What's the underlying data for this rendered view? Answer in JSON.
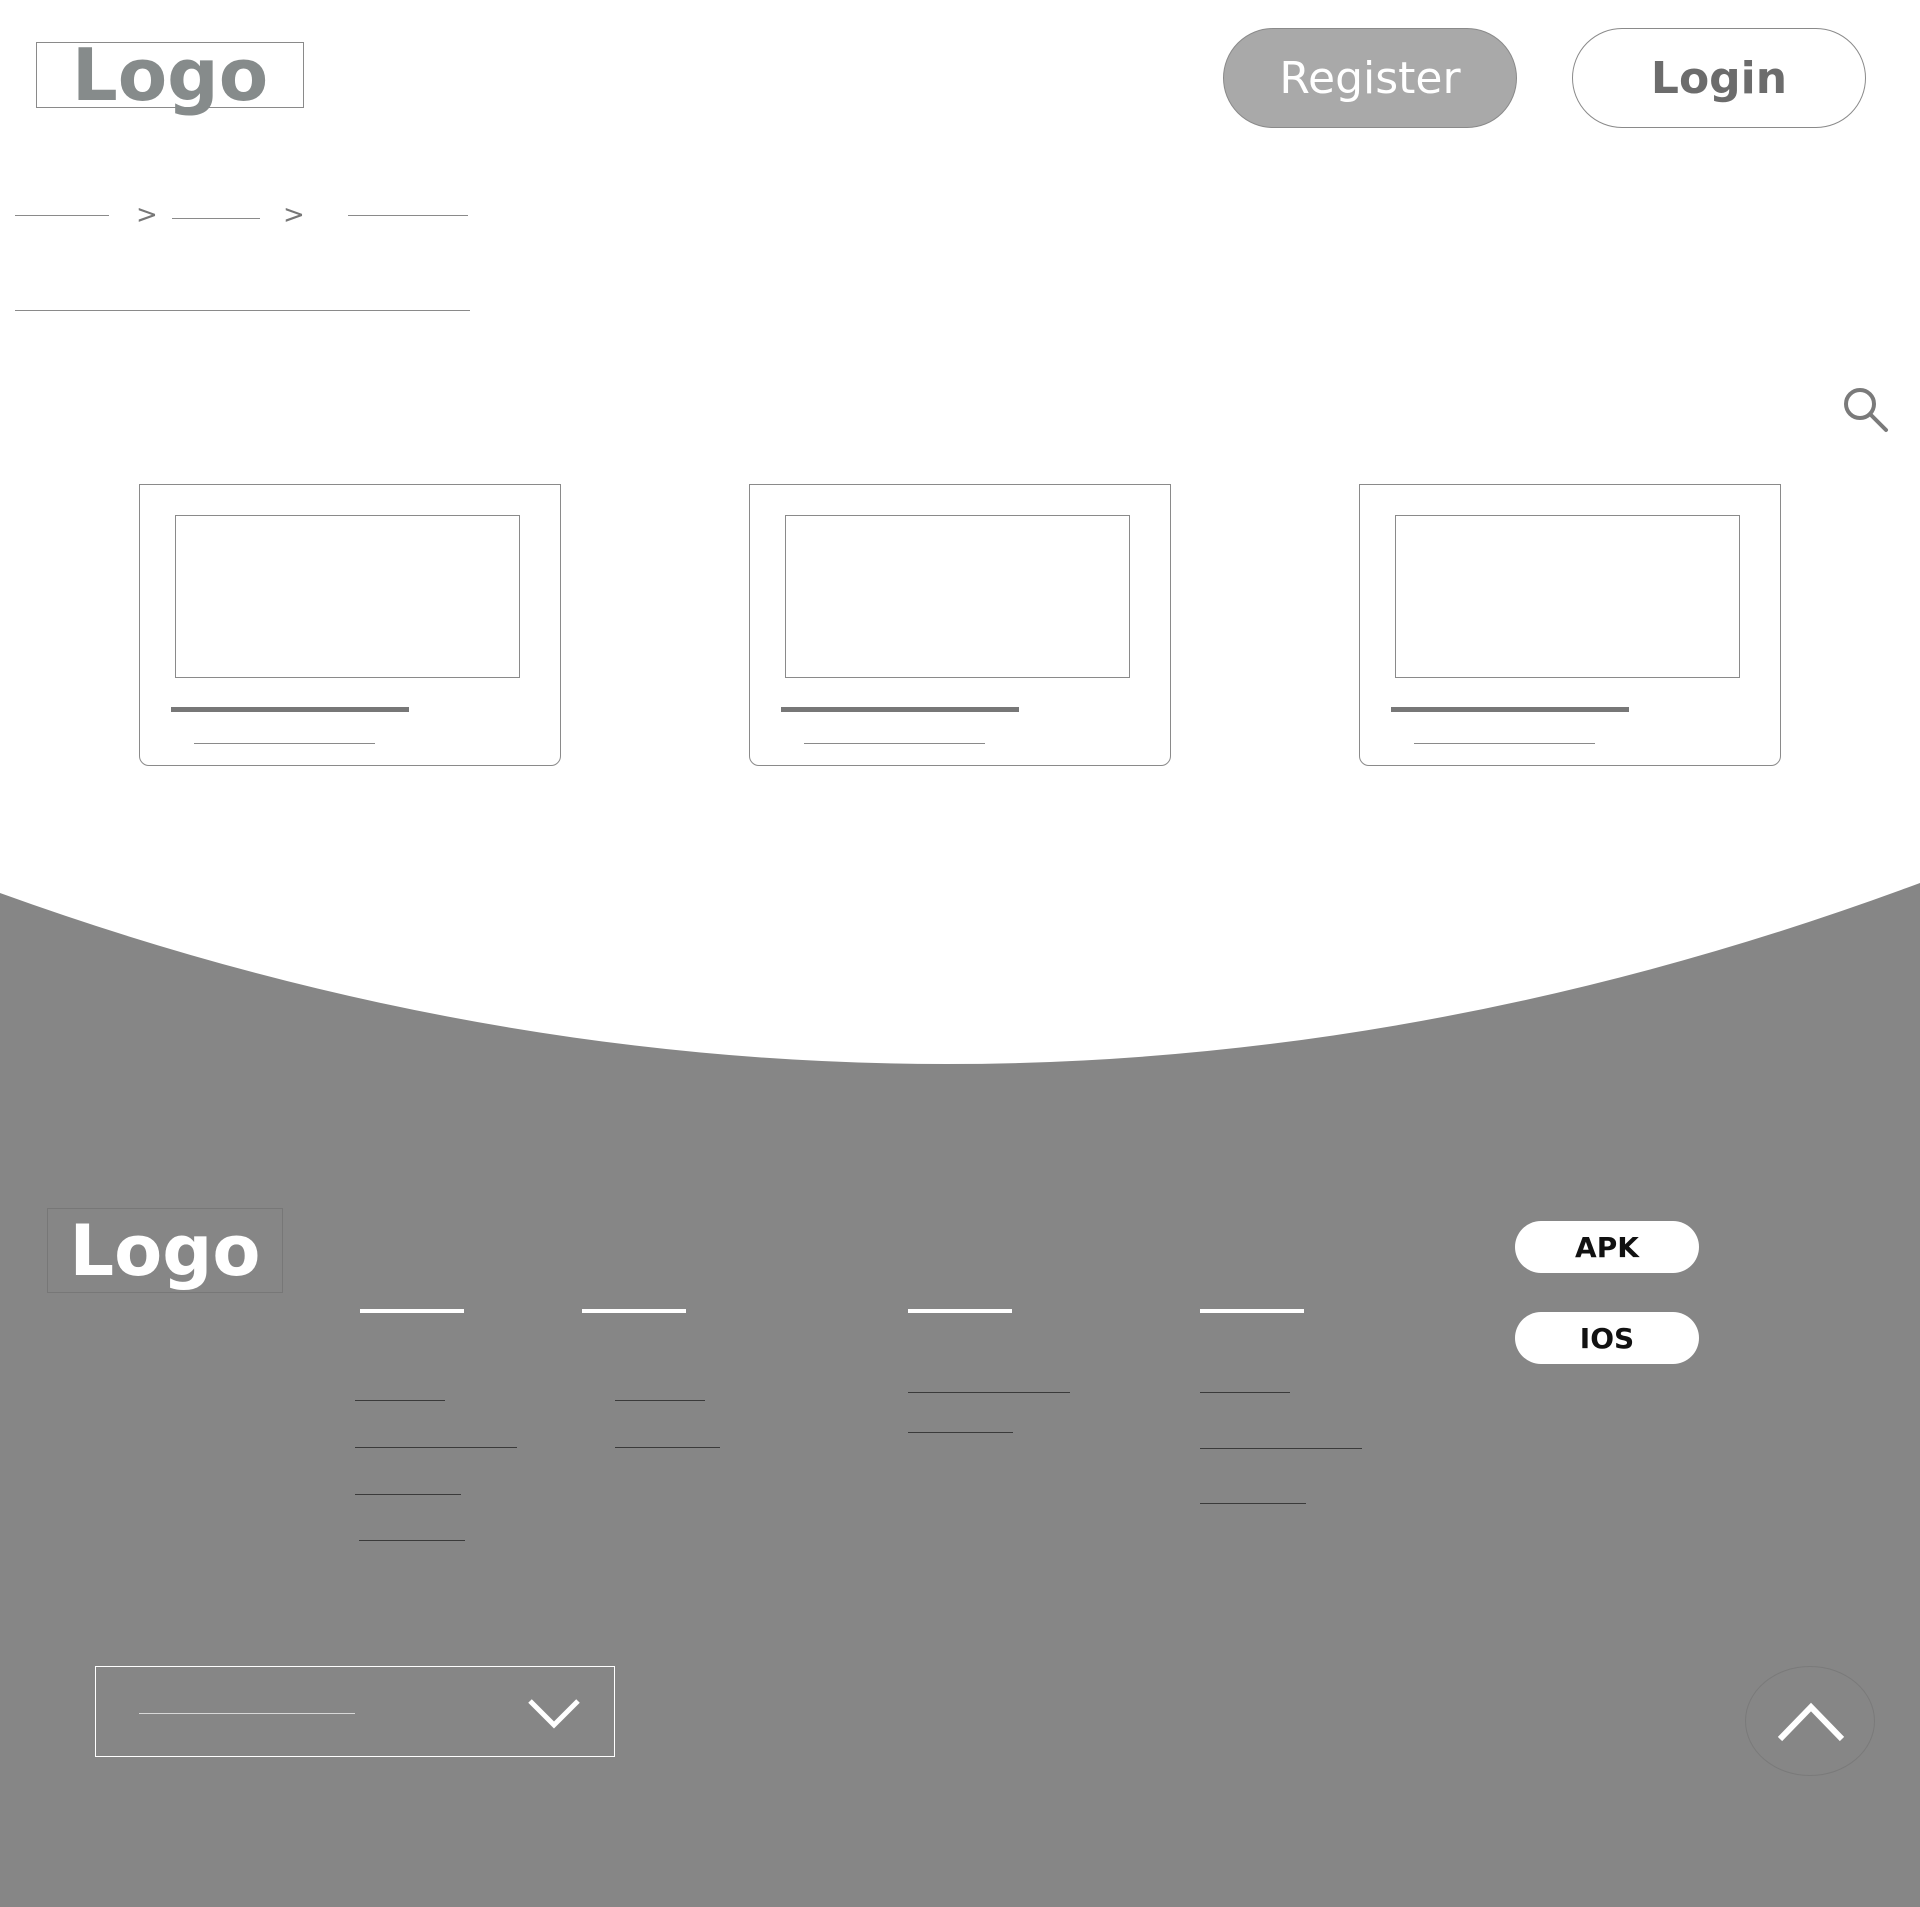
{
  "header": {
    "logo_text": "Logo",
    "register_label": "Register",
    "login_label": "Login"
  },
  "breadcrumb": {
    "separator": ">"
  },
  "search": {
    "icon": "search-icon"
  },
  "cards": [
    {
      "image": "image-placeholder"
    },
    {
      "image": "image-placeholder"
    },
    {
      "image": "image-placeholder"
    }
  ],
  "footer": {
    "logo_text": "Logo",
    "apk_label": "APK",
    "ios_label": "IOS",
    "select_icon": "chevron-down-icon",
    "back_to_top_icon": "chevron-up-icon"
  },
  "colors": {
    "footer_bg": "#868686",
    "register_bg": "#a9a9a9",
    "accent_text": "#6c6c6c"
  }
}
